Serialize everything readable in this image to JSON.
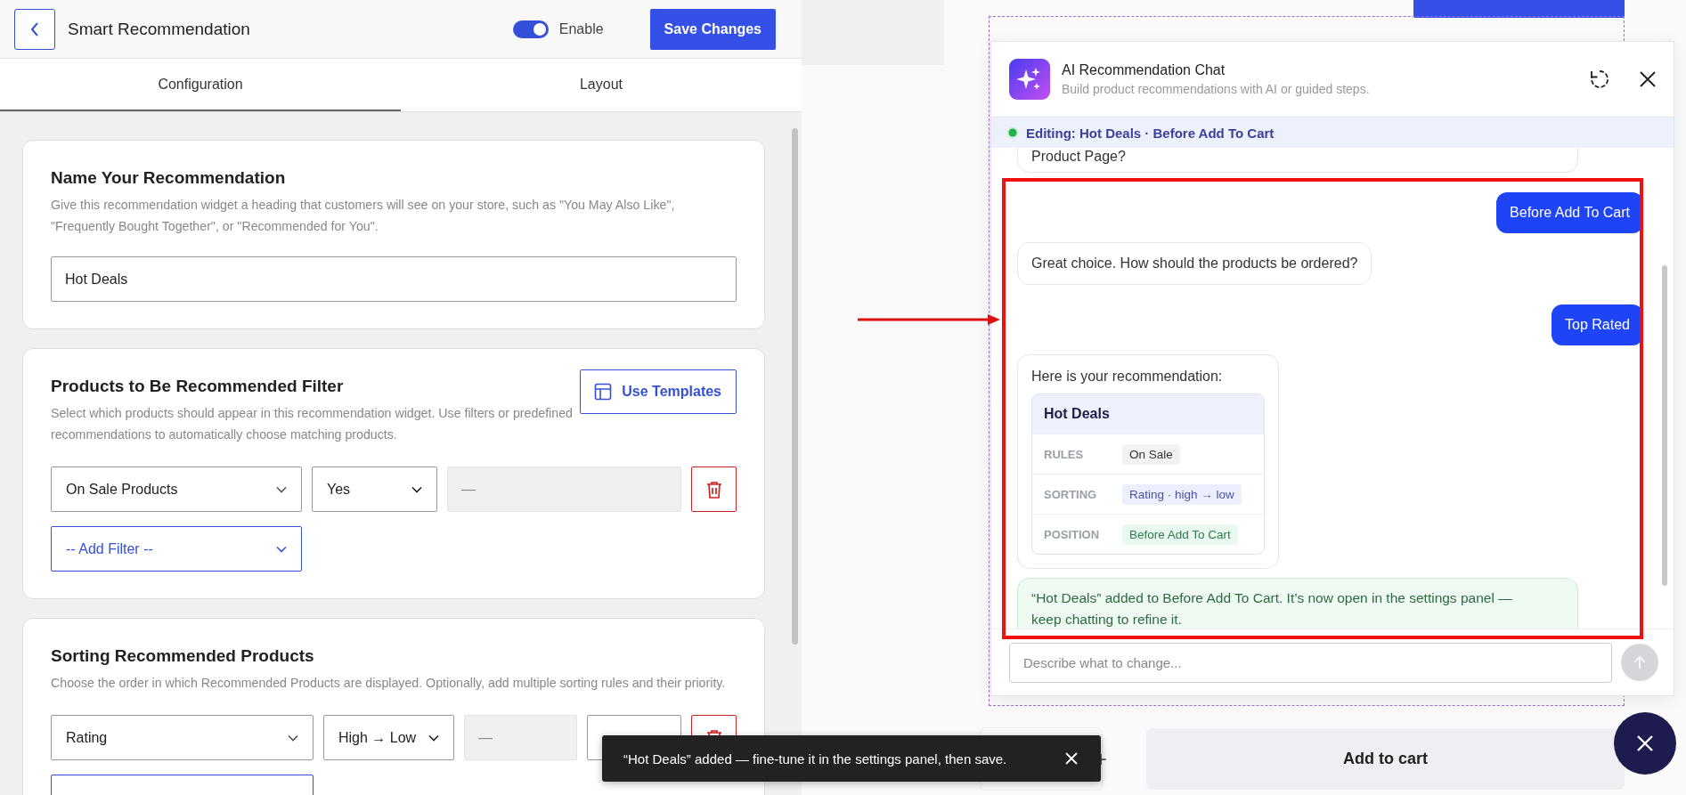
{
  "header": {
    "title": "Smart Recommendation",
    "enable": {
      "label": "Enable",
      "on": true
    },
    "save_button": "Save Changes"
  },
  "tabs": [
    {
      "label": "Configuration",
      "selected": true
    },
    {
      "label": "Layout",
      "selected": false
    }
  ],
  "sections": [
    {
      "kind": "name",
      "title": "Name Your Recommendation",
      "description": "Give this recommendation widget a heading that customers will see on your store, such as \"You May Also Like\", \"Frequently Bought Together\", or \"Recommended for You\".",
      "name_field": {
        "value": "Hot Deals"
      }
    },
    {
      "kind": "filter",
      "title": "Products to Be Recommended Filter",
      "description": "Select which products should appear in this recommendation widget. Use filters or predefined recommendations to automatically choose matching products.",
      "action_button": "Use Templates",
      "rows": [
        {
          "field": "On Sale Products",
          "condition": "Yes",
          "placeholder": "—"
        }
      ],
      "add_filter": "-- Add Filter --"
    },
    {
      "kind": "sorting",
      "title": "Sorting Recommended Products",
      "description": "Choose the order in which Recommended Products are displayed. Optionally, add multiple sorting rules and their priority.",
      "rows": [
        {
          "field": "Rating",
          "condition": "High → Low",
          "placeholder": "—"
        }
      ]
    }
  ],
  "chat": {
    "title": "AI Recommendation Chat",
    "subtitle": "Build product recommendations with AI or guided steps.",
    "editing": "Editing: Hot Deals · Before Add To Cart",
    "messages": [
      {
        "kind": "bot",
        "text": "Product Page?"
      },
      {
        "kind": "user",
        "text": "Before Add To Cart"
      },
      {
        "kind": "bot",
        "text": "Great choice. How should the products be ordered?"
      },
      {
        "kind": "user",
        "text": "Top Rated"
      },
      {
        "kind": "recommendation",
        "text": "Here is your recommendation:",
        "card": {
          "title": "Hot Deals",
          "rows": [
            {
              "label": "RULES",
              "value": "On Sale",
              "kind": "neutral"
            },
            {
              "label": "SORTING",
              "value": "Rating · high → low",
              "kind": "info"
            },
            {
              "label": "POSITION",
              "value": "Before Add To Cart",
              "kind": "success"
            }
          ]
        }
      },
      {
        "kind": "success",
        "text": "“Hot Deals” added to Before Add To Cart. It’s now open in the settings panel — keep chatting to refine it."
      }
    ],
    "input": {
      "placeholder": "Describe what to change..."
    }
  },
  "product": {
    "quantity_plus": "+",
    "add_to_cart": "Add to cart"
  },
  "toast": {
    "text": "“Hot Deals” added — fine-tune it in the settings panel, then save."
  }
}
